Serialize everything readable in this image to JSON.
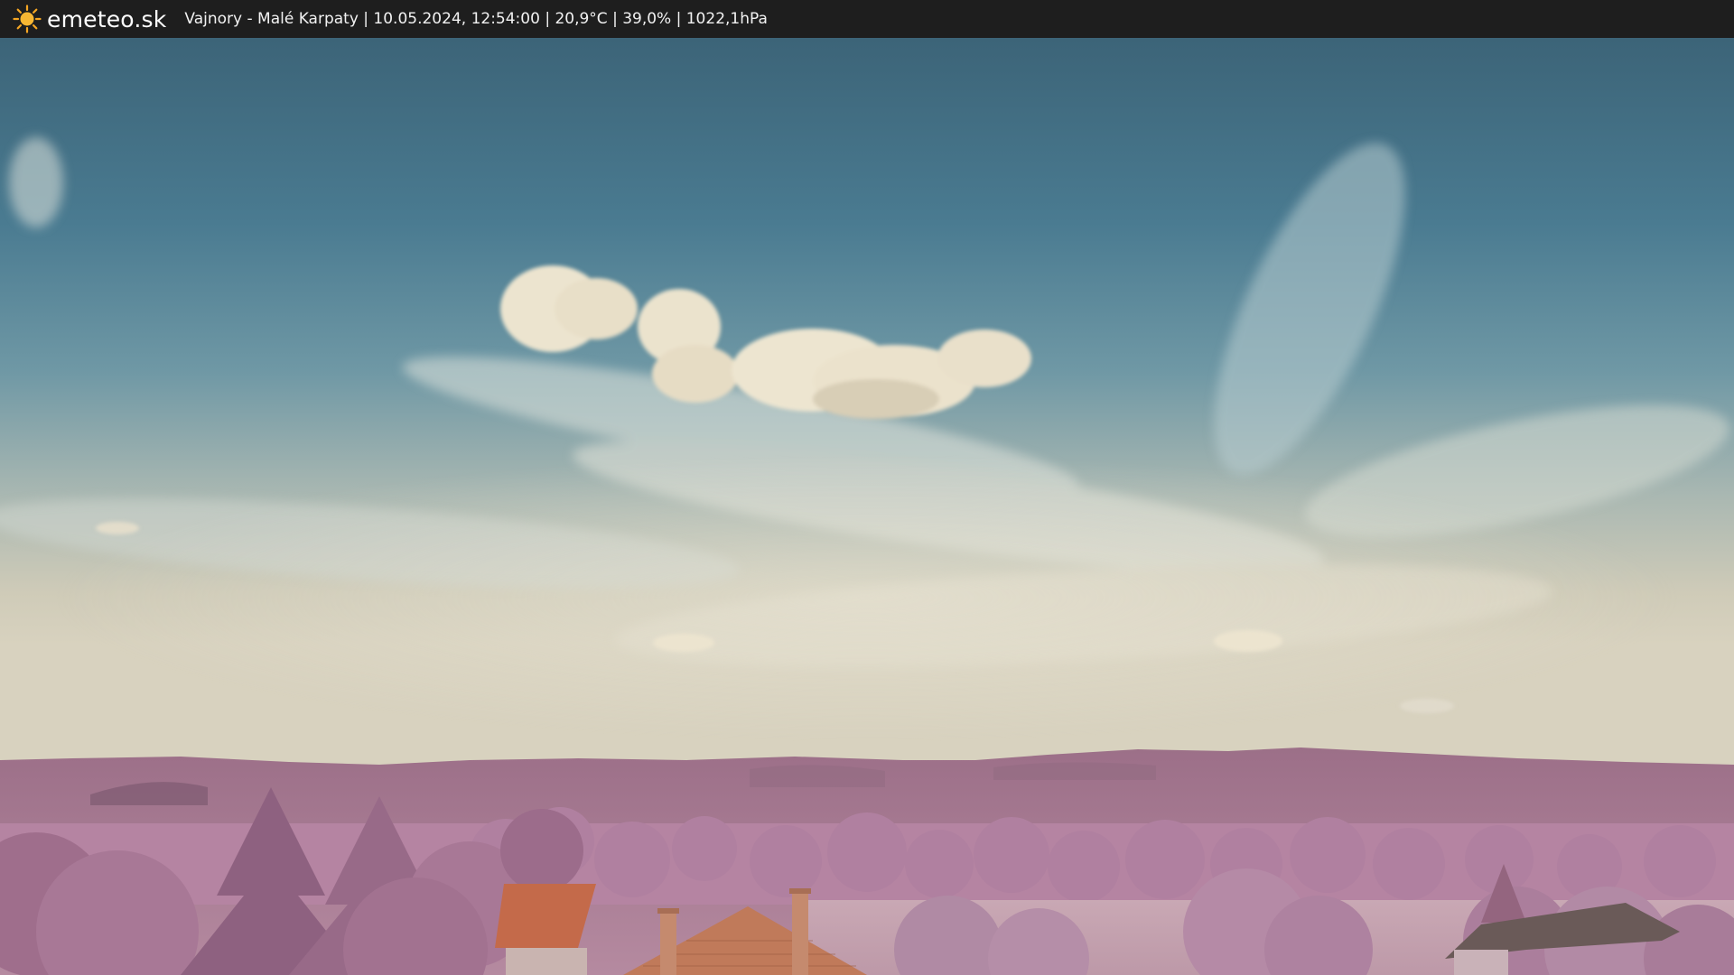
{
  "header": {
    "brand": "emeteo.sk",
    "logo_icon": "sun-icon",
    "station_info": "Vajnory - Malé Karpaty | 10.05.2024, 12:54:00 | 20,9°C | 39,0% | 1022,1hPa"
  },
  "colors": {
    "bar_background": "#1e1e1e",
    "sun": "#f5a623",
    "sky_top": "#3f6a80",
    "sky_horizon": "#d6d0bd",
    "foliage": "#b07a98",
    "roof": "#c46a4a"
  }
}
